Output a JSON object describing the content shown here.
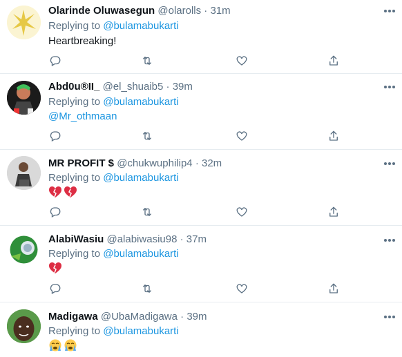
{
  "reply_prefix": "Replying to",
  "tweets": [
    {
      "name": "Olarinde Oluwasegun",
      "handle": "@olarolls",
      "time": "31m",
      "reply_to": "@bulamabukarti",
      "text": "Heartbreaking!",
      "mention": ""
    },
    {
      "name": "Abd0u®II_",
      "handle": "@el_shuaib5",
      "time": "39m",
      "reply_to": "@bulamabukarti",
      "text": "",
      "mention": "@Mr_othmaan"
    },
    {
      "name": "MR PROFIT $",
      "handle": "@chukwuphilip4",
      "time": "32m",
      "reply_to": "@bulamabukarti",
      "text": "",
      "emoji": [
        "broken-heart",
        "broken-heart"
      ]
    },
    {
      "name": "AlabiWasiu",
      "handle": "@alabiwasiu98",
      "time": "37m",
      "reply_to": "@bulamabukarti",
      "text": "",
      "emoji": [
        "broken-heart"
      ]
    },
    {
      "name": "Madigawa",
      "handle": "@UbaMadigawa",
      "time": "39m",
      "reply_to": "@bulamabukarti",
      "text": "",
      "emoji": [
        "crying-face",
        "crying-face"
      ]
    }
  ],
  "colors": {
    "link": "#1b95e0",
    "muted": "#5b7083",
    "text": "#0f1419",
    "divider": "#e6ecf0"
  },
  "icons": [
    "reply-icon",
    "retweet-icon",
    "like-icon",
    "share-icon",
    "more-icon"
  ]
}
